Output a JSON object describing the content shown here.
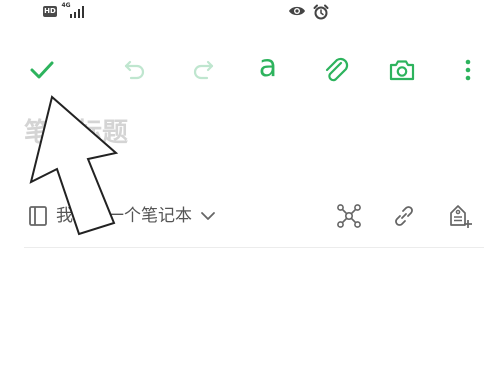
{
  "status_bar": {
    "hd_badge": "HD",
    "network_label": "4G"
  },
  "colors": {
    "accent": "#2db35d",
    "accent_disabled": "#bfe6cf",
    "icon_gray": "#666666",
    "placeholder": "#d4d4d4"
  },
  "toolbar": {
    "font_label": "a"
  },
  "note": {
    "title_placeholder": "笔记标题",
    "notebook_name": "我的第一个笔记本"
  }
}
